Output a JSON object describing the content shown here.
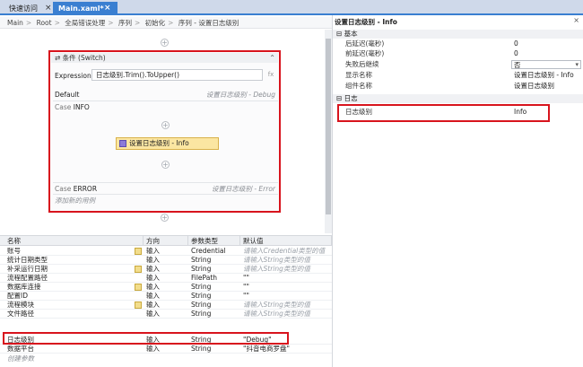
{
  "tabs": [
    {
      "label": "快速访问",
      "close": "×"
    },
    {
      "label": "Main.xaml*",
      "close": "×"
    }
  ],
  "breadcrumb": [
    "Main",
    "Root",
    "全局错误处理",
    "序列",
    "初始化",
    "序列 - 设置日志级别"
  ],
  "switch": {
    "title": "条件 (Switch)",
    "collapse_glyph": "⌃",
    "expression_label": "Expression",
    "expression_value": "日志级别.Trim().ToUpper()",
    "fx_label": "fx",
    "default_label": "Default",
    "default_target": "设置日志级别 - Debug",
    "case1_key": "Case",
    "case1_value": "INFO",
    "activity_label": "设置日志级别 - Info",
    "case2_key": "Case",
    "case2_value": "ERROR",
    "case2_target": "设置日志级别 - Error",
    "add_case": "添加新的用例"
  },
  "arguments": {
    "headers": {
      "name": "名称",
      "direction": "方向",
      "type": "参数类型",
      "default": "默认值"
    },
    "rows": [
      {
        "name": "账号",
        "direction": "输入",
        "type": "Credential",
        "default": "请输入Credential类型的值",
        "filled": false,
        "icon": true
      },
      {
        "name": "统计日期类型",
        "direction": "输入",
        "type": "String",
        "default": "请输入String类型的值",
        "filled": false,
        "icon": false
      },
      {
        "name": "补采运行日期",
        "direction": "输入",
        "type": "String",
        "default": "请输入String类型的值",
        "filled": false,
        "icon": true
      },
      {
        "name": "流程配置路径",
        "direction": "输入",
        "type": "FilePath",
        "default": "\"\"",
        "filled": true,
        "icon": false
      },
      {
        "name": "数据库连接",
        "direction": "输入",
        "type": "String",
        "default": "\"\"",
        "filled": true,
        "icon": true
      },
      {
        "name": "配置ID",
        "direction": "输入",
        "type": "String",
        "default": "\"\"",
        "filled": true,
        "icon": false
      },
      {
        "name": "流程模块",
        "direction": "输入",
        "type": "String",
        "default": "请输入String类型的值",
        "filled": false,
        "icon": true
      },
      {
        "name": "文件路径",
        "direction": "输入",
        "type": "String",
        "default": "请输入String类型的值",
        "filled": false,
        "icon": false
      },
      {
        "name": "日志级别",
        "direction": "输入",
        "type": "String",
        "default": "\"Debug\"",
        "filled": true,
        "icon": false
      },
      {
        "name": "数据平台",
        "direction": "输入",
        "type": "String",
        "default": "\"抖音电商罗盘\"",
        "filled": true,
        "icon": false
      }
    ],
    "create_label": "创建参数"
  },
  "properties": {
    "title": "设置日志级别 - Info",
    "close": "×",
    "cat_basic": "基本",
    "cat_log": "日志",
    "basic": [
      {
        "key": "后延迟(毫秒)",
        "value": "0"
      },
      {
        "key": "前延迟(毫秒)",
        "value": "0"
      },
      {
        "key": "失败后继续",
        "value": "否"
      },
      {
        "key": "显示名称",
        "value": "设置日志级别 - Info"
      },
      {
        "key": "组件名称",
        "value": "设置日志级别"
      }
    ],
    "log": [
      {
        "key": "日志级别",
        "value": "Info"
      }
    ]
  },
  "colors": {
    "accent": "#3a7fd1",
    "highlight": "#d8141d",
    "activity": "#fbe6a2"
  }
}
